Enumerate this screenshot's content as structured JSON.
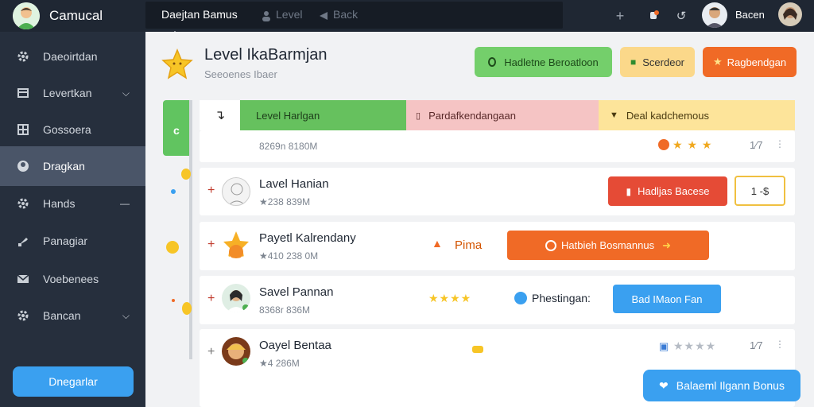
{
  "app": {
    "title": "Camucal"
  },
  "sidebar": {
    "items": [
      {
        "label": "Daeoirtdan",
        "icon": "gear-icon"
      },
      {
        "label": "Levertkan",
        "icon": "document-icon"
      },
      {
        "label": "Gossoera",
        "icon": "table-icon"
      },
      {
        "label": "Dragkan",
        "icon": "user-circle-icon"
      },
      {
        "label": "Hands",
        "icon": "gear-icon"
      },
      {
        "label": "Panagiar",
        "icon": "wrench-icon"
      },
      {
        "label": "Voebenees",
        "icon": "mail-icon"
      },
      {
        "label": "Bancan",
        "icon": "gear-icon"
      }
    ],
    "button": "Dnegarlar"
  },
  "topbar": {
    "tab_active": "Daejtan Bamus",
    "tab2": "Level",
    "tab3": "Back",
    "user": "Bacen"
  },
  "header": {
    "title": "Level IkaBarmjan",
    "subtitle": "Seeoenes Ibaer",
    "btn1": "Hadletne Beroatloon",
    "btn2": "Scerdeor",
    "btn3": "Ragbendgan"
  },
  "columns": {
    "c1": "Level Harlgan",
    "c2": "Pardafkendangaan",
    "c3": "Deal kadchemous"
  },
  "rows": [
    {
      "name": "",
      "sub": "8269n 8180M",
      "stars": "★ ★ ★",
      "rating": "1⁄7"
    },
    {
      "name": "Lavel Hanian",
      "sub": "★238 839M",
      "action": "Hadljas Bacese",
      "count": "1 -$"
    },
    {
      "name": "Payetl Kalrendany",
      "sub": "★410 238 0M",
      "tag": "Pima",
      "action": "Hatbieh Bosmannus"
    },
    {
      "name": "Savel Pannan",
      "sub": "8368r 836M",
      "stars": "★★★★",
      "tag": "Phestingan:",
      "action": "Bad IMaon Fan"
    },
    {
      "name": "Oayel Bentaa",
      "sub": "★4 286M",
      "stars": "★★★★",
      "rating": "1⁄7"
    }
  ],
  "float_button": "Balaeml Ilgann Bonus",
  "colors": {
    "green": "#66c15e",
    "orange": "#f06a26",
    "red": "#e54b36",
    "blue": "#3aa0f0",
    "yellow": "#fbd88a",
    "sidebar": "#262f3d"
  }
}
